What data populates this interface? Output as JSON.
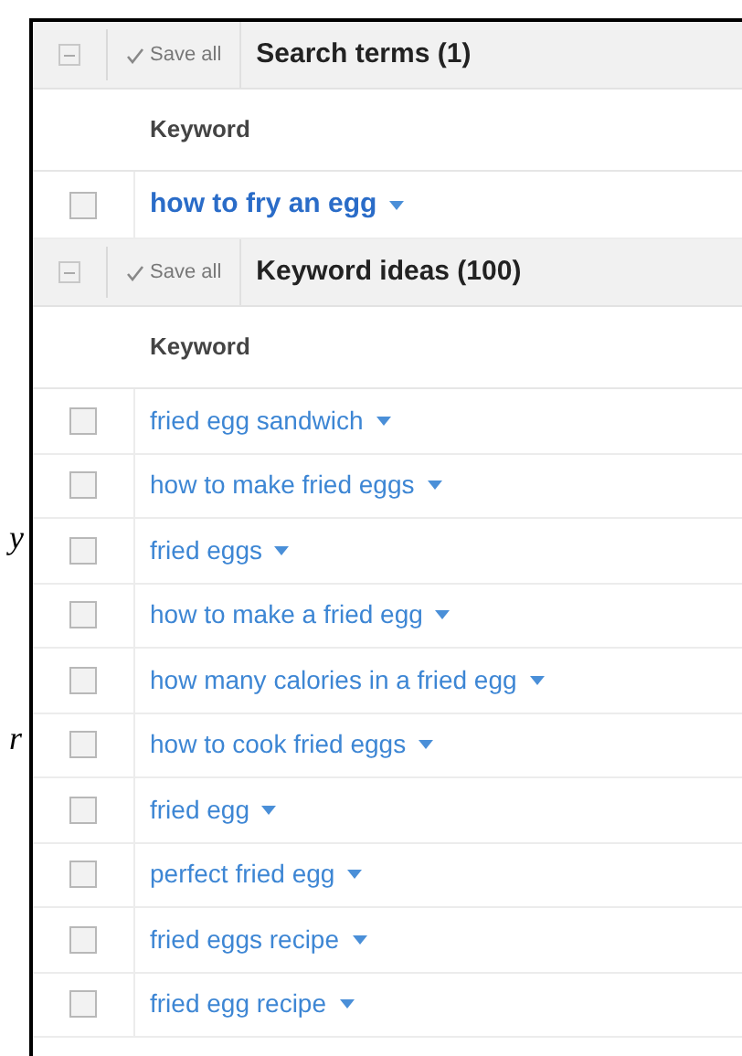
{
  "margin_fragments": [
    "y",
    "r"
  ],
  "sections": [
    {
      "expanded": true,
      "save_label": "Save all",
      "title": "Search terms (1)",
      "column": "Keyword",
      "kind": "search_terms",
      "rows": [
        {
          "keyword": "how to fry an egg",
          "checked": false
        }
      ]
    },
    {
      "expanded": true,
      "save_label": "Save all",
      "title": "Keyword ideas (100)",
      "column": "Keyword",
      "kind": "ideas",
      "rows": [
        {
          "keyword": "fried egg sandwich",
          "checked": false
        },
        {
          "keyword": "how to make fried eggs",
          "checked": false
        },
        {
          "keyword": "fried eggs",
          "checked": false
        },
        {
          "keyword": "how to make a fried egg",
          "checked": false
        },
        {
          "keyword": "how many calories in a fried egg",
          "checked": false
        },
        {
          "keyword": "how to cook fried eggs",
          "checked": false
        },
        {
          "keyword": "fried egg",
          "checked": false
        },
        {
          "keyword": "perfect fried egg",
          "checked": false
        },
        {
          "keyword": "fried eggs recipe",
          "checked": false
        },
        {
          "keyword": "fried egg recipe",
          "checked": false
        }
      ]
    }
  ]
}
